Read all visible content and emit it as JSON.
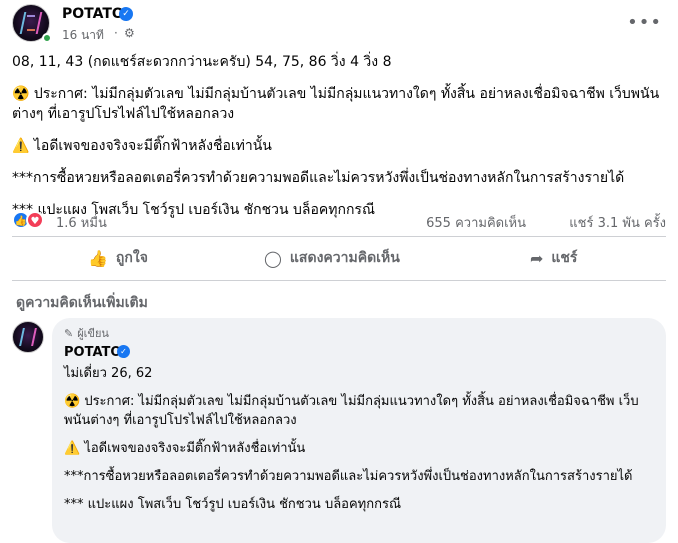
{
  "post": {
    "page_name": "POTATO",
    "time": "16 นาที",
    "time_separator": "·",
    "lines": [
      "08, 11, 43 (กดแชร์สะดวกกว่านะครับ) 54, 75, 86 วิ่ง 4 วิ่ง 8",
      "☢️ ประกาศ: ไม่มีกลุ่มตัวเลข ไม่มีกลุ่มบ้านตัวเลข ไม่มีกลุ่มแนวทางใดๆ ทั้งสิ้น อย่าหลงเชื่อมิจฉาชีพ เว็บพนันต่างๆ ที่เอารูปโปรไฟล์ไปใช้หลอกลวง",
      "⚠️ ไอดีเพจของจริงจะมีติ๊กฟ้าหลังชื่อเท่านั้น",
      "***การซื้อหวยหรือลอตเตอรี่ควรทำด้วยความพอดีและไม่ควรหวังพึ่งเป็นช่องทางหลักในการสร้างรายได้",
      "*** แปะแผง โพสเว็บ โชว์รูป เบอร์เงิน ชักชวน บล็อคทุกกรณี"
    ]
  },
  "stats": {
    "reactions": "1.6 หมื่น",
    "comments": "655 ความคิดเห็น",
    "shares": "แชร์ 3.1 พัน ครั้ง"
  },
  "actions": {
    "like": "ถูกใจ",
    "comment": "แสดงความคิดเห็น",
    "share": "แชร์"
  },
  "more_comments_label": "ดูความคิดเห็นเพิ่มเติม",
  "comment": {
    "author_badge": "ผู้เขียน",
    "name": "POTATO",
    "lines": [
      "ไม่เดี่ยว 26, 62",
      "☢️ ประกาศ: ไม่มีกลุ่มตัวเลข ไม่มีกลุ่มบ้านตัวเลข ไม่มีกลุ่มแนวทางใดๆ ทั้งสิ้น อย่าหลงเชื่อมิจฉาชีพ เว็บพนันต่างๆ ที่เอารูปโปรไฟล์ไปใช้หลอกลวง",
      "⚠️ ไอดีเพจของจริงจะมีติ๊กฟ้าหลังชื่อเท่านั้น",
      "***การซื้อหวยหรือลอตเตอรี่ควรทำด้วยความพอดีและไม่ควรหวังพึ่งเป็นช่องทางหลักในการสร้างรายได้",
      "*** แปะแผง โพสเว็บ โชว์รูป เบอร์เงิน ชักชวน บล็อคทุกกรณี"
    ]
  },
  "icons": {
    "more": "more-options-icon",
    "close": "close-icon",
    "globe": "globe-icon",
    "like": "thumbs-up-icon",
    "comment": "comment-icon",
    "share": "share-icon",
    "verified": "verified-badge-icon",
    "author": "pencil-icon"
  },
  "colors": {
    "accent": "#1877f2",
    "love": "#f33e58",
    "online": "#31a24c",
    "muted": "#65676b",
    "comment_bg": "#f0f2f5"
  }
}
